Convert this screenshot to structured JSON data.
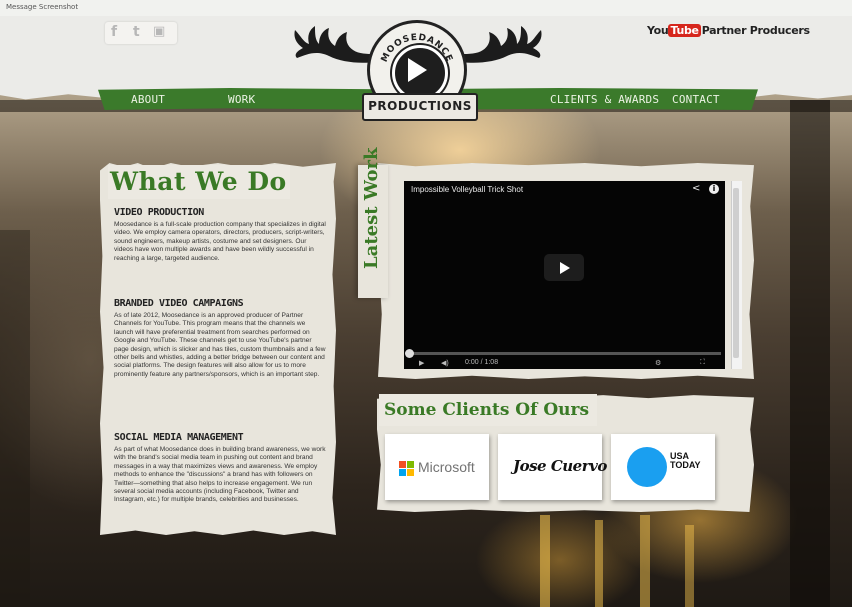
{
  "browser": {
    "title": "Message Screenshot"
  },
  "social": {
    "icons": [
      "facebook-icon",
      "twitter-icon",
      "youtube-icon"
    ],
    "glyphs": [
      "f",
      "t",
      "▣"
    ]
  },
  "youtube_badge": {
    "you": "You",
    "tube": "Tube",
    "rest": "Partner Producers"
  },
  "logo": {
    "arc_text": "MOOSEDANCE",
    "banner_text": "PRODUCTIONS"
  },
  "nav": {
    "items": [
      "ABOUT",
      "WORK",
      "CLIENTS & AWARDS",
      "CONTACT"
    ]
  },
  "what_we_do": {
    "title": "What We Do",
    "sections": [
      {
        "heading": "VIDEO PRODUCTION",
        "body": "Moosedance is a full-scale production company that specializes in digital video. We employ camera operators, directors, producers, script-writers, sound engineers, makeup artists, costume and set designers. Our videos have won multiple awards and have been wildly successful in reaching a large, targeted audience."
      },
      {
        "heading": "BRANDED VIDEO CAMPAIGNS",
        "body": "As of late 2012, Moosedance is an approved producer of Partner Channels for YouTube. This program means that the channels we launch will have preferential treatment from searches performed on Google and YouTube. These channels get to use YouTube's partner page design, which is slicker and has tiles, custom thumbnails and a few other bells and whistles, adding a better bridge between our content and social platforms. The design features will also allow for us to more prominently feature any partners/sponsors, which is an important step."
      },
      {
        "heading": "SOCIAL MEDIA MANAGEMENT",
        "body": "As part of what Moosedance does in building brand awareness, we work with the brand's social media team in pushing out content and brand messages in a way that maximizes views and awareness. We employ methods to enhance the \"discussions\" a brand has with followers on Twitter—something that also helps to increase engagement. We run several social media accounts (including Facebook, Twitter and Instagram, etc.) for multiple brands, celebrities and businesses."
      }
    ]
  },
  "latest_work": {
    "label": "Latest Work",
    "video": {
      "title": "Impossible Volleyball Trick Shot",
      "time": "0:00 / 1:08"
    }
  },
  "clients": {
    "title": "Some Clients Of Ours",
    "items": [
      "Microsoft",
      "Jose Cuervo",
      "USA TODAY"
    ],
    "colors": {
      "ms_red": "#f25022",
      "ms_green": "#7fba00",
      "ms_blue": "#00a4ef",
      "ms_yellow": "#ffb900",
      "usa_blue": "#1a9ff0"
    }
  },
  "theme": {
    "accent": "#3a7a26",
    "nav_bg": "#3b7a2b",
    "paper": "#e8e5dc"
  }
}
